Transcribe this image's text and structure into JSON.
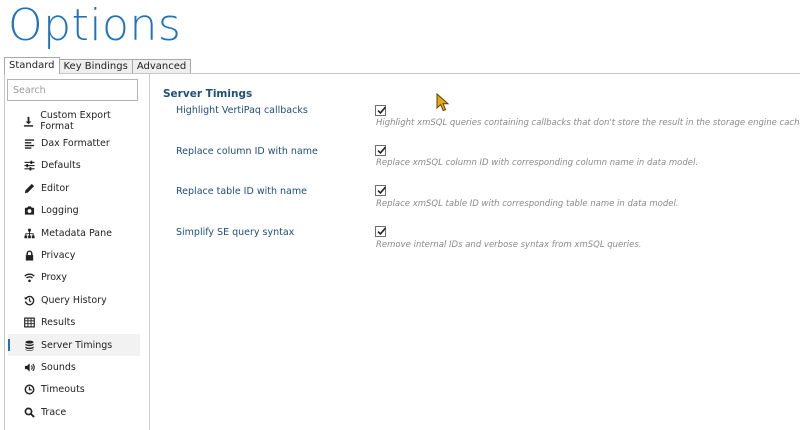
{
  "window": {
    "title": "Options"
  },
  "tabs": [
    {
      "label": "Standard",
      "active": true
    },
    {
      "label": "Key Bindings",
      "active": false
    },
    {
      "label": "Advanced",
      "active": false
    }
  ],
  "search": {
    "placeholder": "Search",
    "value": ""
  },
  "sidebar": {
    "items": [
      {
        "label": "Custom Export Format",
        "icon": "download-icon"
      },
      {
        "label": "Dax Formatter",
        "icon": "align-left-icon"
      },
      {
        "label": "Defaults",
        "icon": "sliders-icon"
      },
      {
        "label": "Editor",
        "icon": "pencil-icon"
      },
      {
        "label": "Logging",
        "icon": "camera-icon"
      },
      {
        "label": "Metadata Pane",
        "icon": "sitemap-icon"
      },
      {
        "label": "Privacy",
        "icon": "lock-icon"
      },
      {
        "label": "Proxy",
        "icon": "wifi-icon"
      },
      {
        "label": "Query History",
        "icon": "history-icon"
      },
      {
        "label": "Results",
        "icon": "table-icon"
      },
      {
        "label": "Server Timings",
        "icon": "database-icon",
        "selected": true
      },
      {
        "label": "Sounds",
        "icon": "volume-icon"
      },
      {
        "label": "Timeouts",
        "icon": "clock-icon"
      },
      {
        "label": "Trace",
        "icon": "search-icon"
      }
    ]
  },
  "section": {
    "title": "Server Timings",
    "options": [
      {
        "label": "Highlight VertiPaq callbacks",
        "checked": true,
        "description": "Highlight xmSQL queries containing callbacks that don't store the result in the storage engine cache."
      },
      {
        "label": "Replace column ID with name",
        "checked": true,
        "description": "Replace xmSQL column ID with corresponding column name in data model."
      },
      {
        "label": "Replace table ID with name",
        "checked": true,
        "description": "Replace xmSQL table ID with corresponding table name in data model."
      },
      {
        "label": "Simplify SE query syntax",
        "checked": true,
        "description": "Remove internal IDs and verbose syntax from xmSQL queries."
      }
    ]
  },
  "colors": {
    "accent": "#1e73be",
    "label": "#1f4e79",
    "description": "#8a8a8a"
  }
}
